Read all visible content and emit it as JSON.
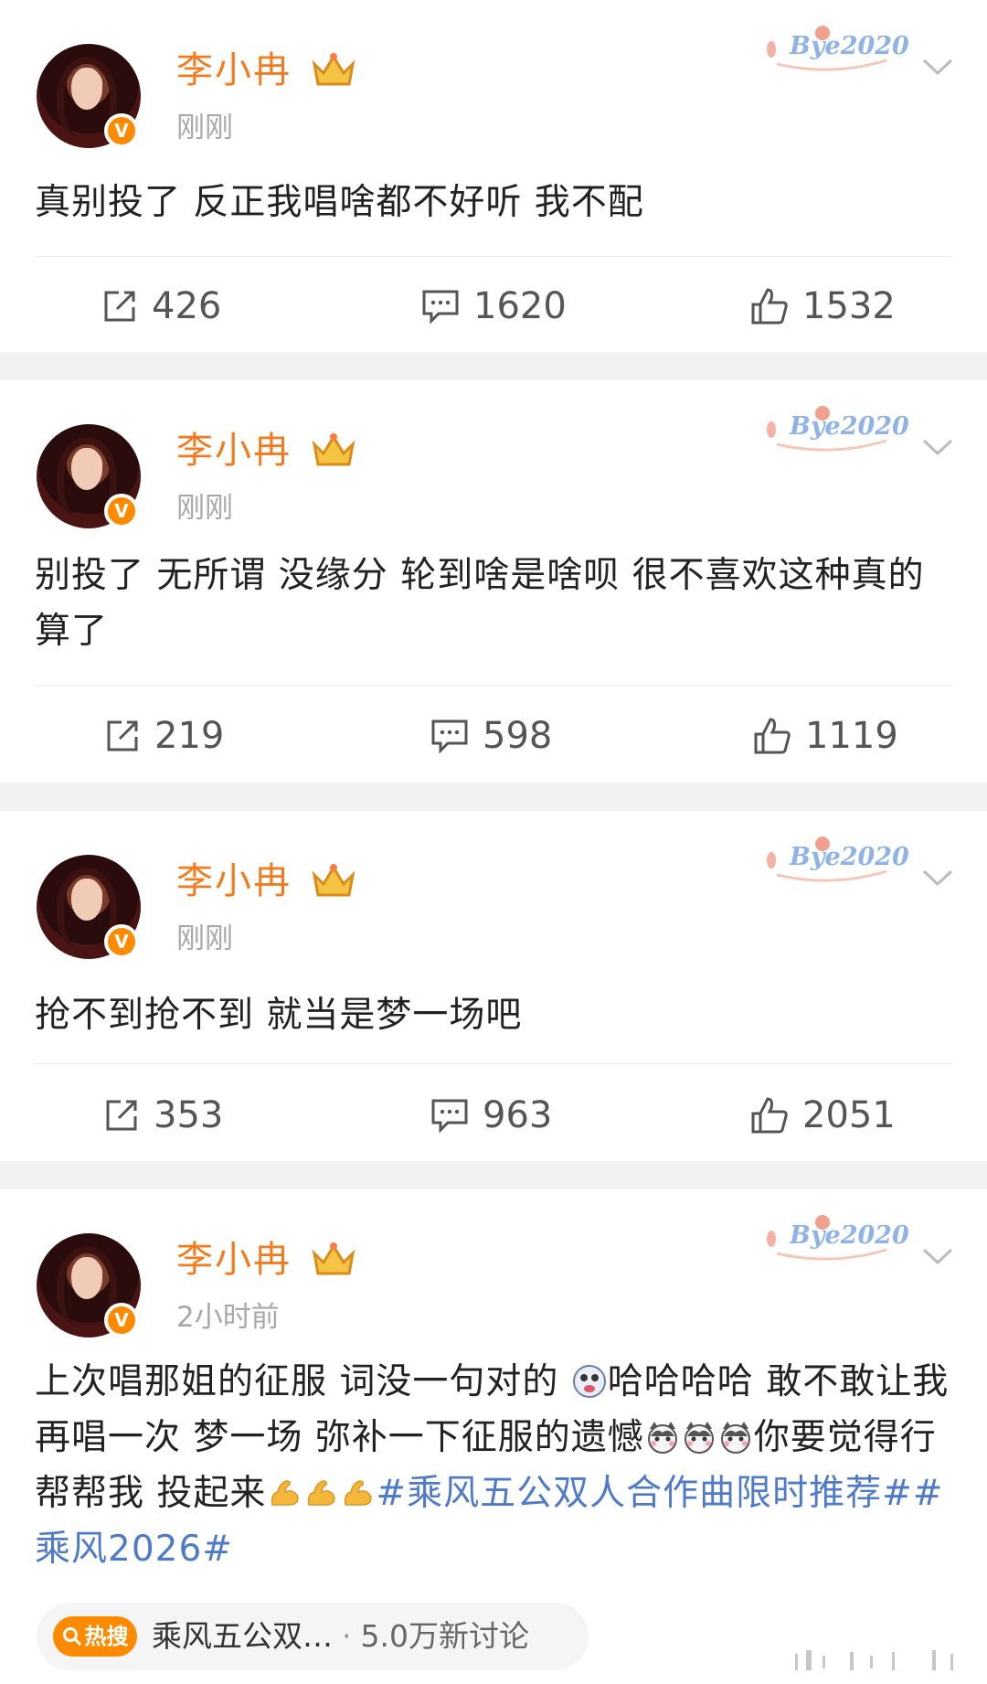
{
  "posts": [
    {
      "author": "李小冉",
      "time": "刚刚",
      "text": "真别投了 反正我唱啥都不好听 我不配",
      "reposts": "426",
      "comments": "1620",
      "likes": "1532"
    },
    {
      "author": "李小冉",
      "time": "刚刚",
      "text": "别投了 无所谓 没缘分 轮到啥是啥呗 很不喜欢这种真的  算了",
      "reposts": "219",
      "comments": "598",
      "likes": "1119"
    },
    {
      "author": "李小冉",
      "time": "刚刚",
      "text": "抢不到抢不到 就当是梦一场吧",
      "reposts": "353",
      "comments": "963",
      "likes": "2051"
    },
    {
      "author": "李小冉",
      "time": "2小时前",
      "text_a": "上次唱那姐的征服 词没一句对的 ",
      "text_b": "哈哈哈哈 敢不敢让我再唱一次 梦一场 弥补一下征服的遗憾",
      "text_c": "你要觉得行 帮帮我 投起来",
      "hashtag_1": "#乘风五公双人合作曲限时推荐#",
      "hashtag_2": "#乘风2026#"
    }
  ],
  "decoration_label": "Bye2020",
  "hot_search": {
    "badge": "热搜",
    "title": "乘风五公双…",
    "separator": "·",
    "count": "5.0万新讨论"
  },
  "colors": {
    "name": "#f37b1d",
    "verified": "#ff8a00",
    "hashtag": "#4f7ac9",
    "time": "#a8a8a8"
  },
  "icons": [
    "repost-icon",
    "comment-icon",
    "like-icon",
    "verified-badge-icon",
    "member-crown-icon",
    "chevron-down-icon",
    "search-icon"
  ]
}
